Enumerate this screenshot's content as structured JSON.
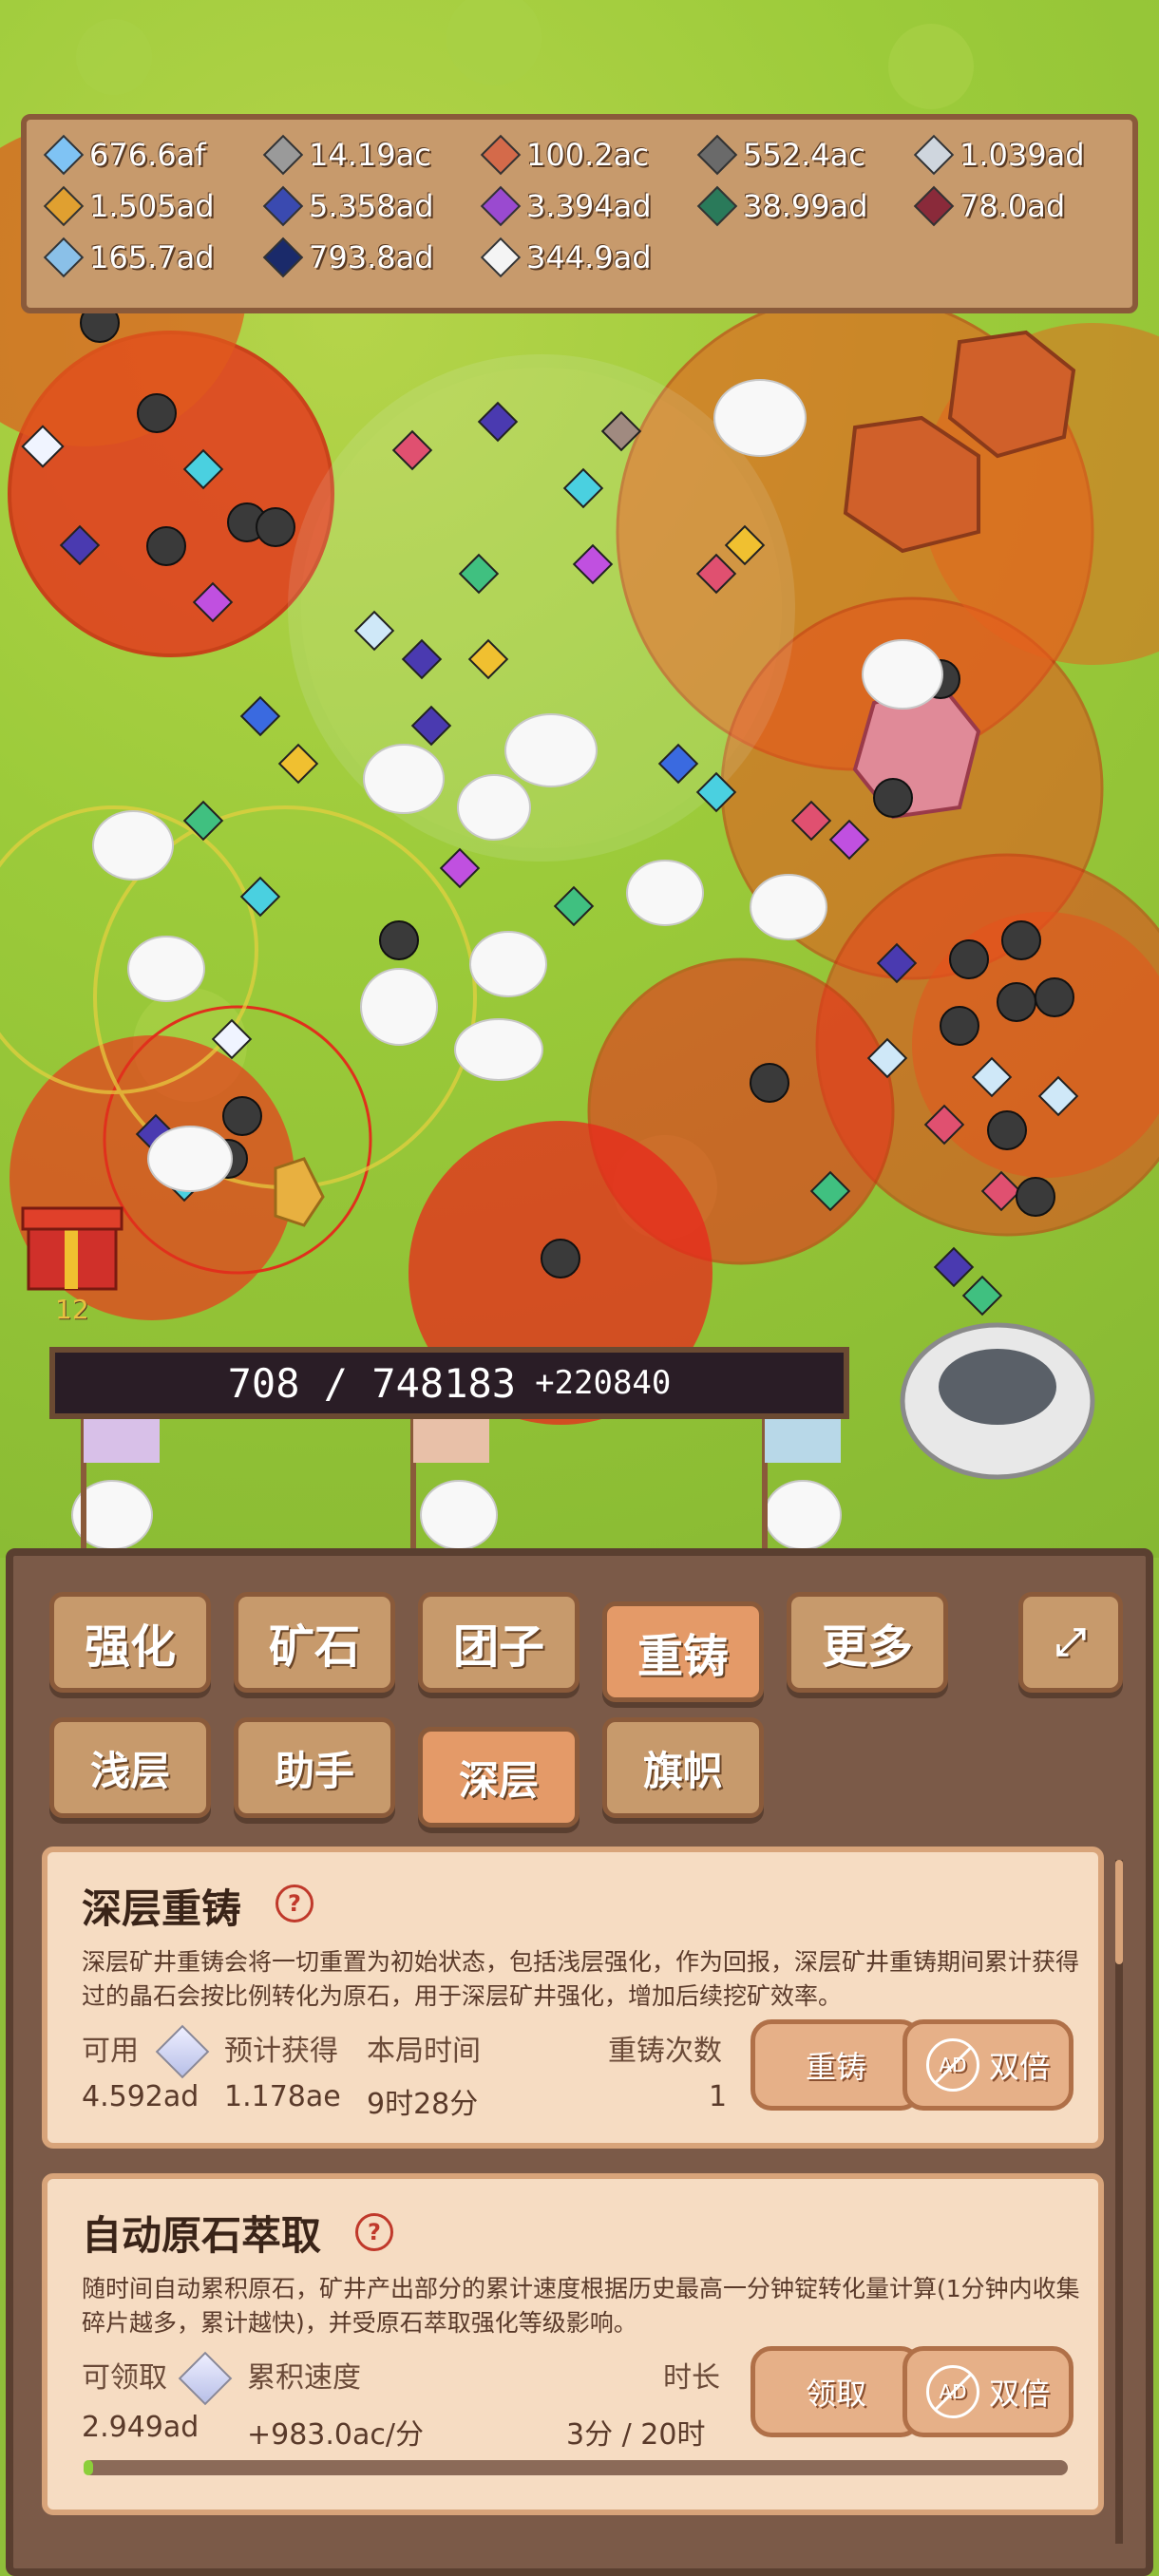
{
  "resources": [
    {
      "value": "676.6af",
      "color": "#7fc3f4",
      "icon": "blue-crystal-icon"
    },
    {
      "value": "14.19ac",
      "color": "#9a9a9a",
      "icon": "iron-ingot-icon"
    },
    {
      "value": "100.2ac",
      "color": "#d46a4a",
      "icon": "copper-ingot-icon"
    },
    {
      "value": "552.4ac",
      "color": "#6a6a6a",
      "icon": "steel-ingot-icon"
    },
    {
      "value": "1.039ad",
      "color": "#cfd6de",
      "icon": "silver-ingot-icon"
    },
    {
      "value": "1.505ad",
      "color": "#e0a030",
      "icon": "gold-ingot-icon"
    },
    {
      "value": "5.358ad",
      "color": "#3a4ab0",
      "icon": "cobalt-ingot-icon"
    },
    {
      "value": "3.394ad",
      "color": "#9a4ad0",
      "icon": "amethyst-icon"
    },
    {
      "value": "38.99ad",
      "color": "#2a7a5a",
      "icon": "emerald-ingot-icon"
    },
    {
      "value": "78.0ad",
      "color": "#8a2a3a",
      "icon": "ruby-ingot-icon"
    },
    {
      "value": "165.7ad",
      "color": "#8ac0e8",
      "icon": "ice-ingot-icon"
    },
    {
      "value": "793.8ad",
      "color": "#1a2a6a",
      "icon": "sapphire-ingot-icon"
    },
    {
      "value": "344.9ad",
      "color": "#f4f4f4",
      "icon": "white-crystal-icon"
    }
  ],
  "progress": {
    "current": "708 / 748183",
    "plus": "+220840"
  },
  "gift_count": "12",
  "tabs": [
    "强化",
    "矿石",
    "团子",
    "重铸",
    "更多"
  ],
  "subtabs": [
    "浅层",
    "助手",
    "深层",
    "旗帜"
  ],
  "card1": {
    "title": "深层重铸",
    "desc": "深层矿井重铸会将一切重置为初始状态，包括浅层强化，作为回报，深层矿井重铸期间累计获得过的晶石会按比例转化为原石，用于深层矿井强化，增加后续挖矿效率。",
    "lbl_available": "可用",
    "lbl_expected": "预计获得",
    "lbl_time": "本局时间",
    "lbl_count": "重铸次数",
    "val_available": "4.592ad",
    "val_expected": "1.178ae",
    "val_time": "9时28分",
    "val_count": "1",
    "btn_recast": "重铸",
    "btn_double": "双倍"
  },
  "card2": {
    "title": "自动原石萃取",
    "desc": "随时间自动累积原石，矿井产出部分的累计速度根据历史最高一分钟锭转化量计算(1分钟内收集碎片越多，累计越快)，并受原石萃取强化等级影响。",
    "lbl_claimable": "可领取",
    "lbl_speed": "累积速度",
    "lbl_duration": "时长",
    "val_claimable": "2.949ad",
    "val_speed": "+983.0ac/分",
    "val_duration": "3分 / 20时",
    "btn_claim": "领取",
    "btn_double": "双倍",
    "progress": 0.01
  },
  "ad_label": "AD"
}
